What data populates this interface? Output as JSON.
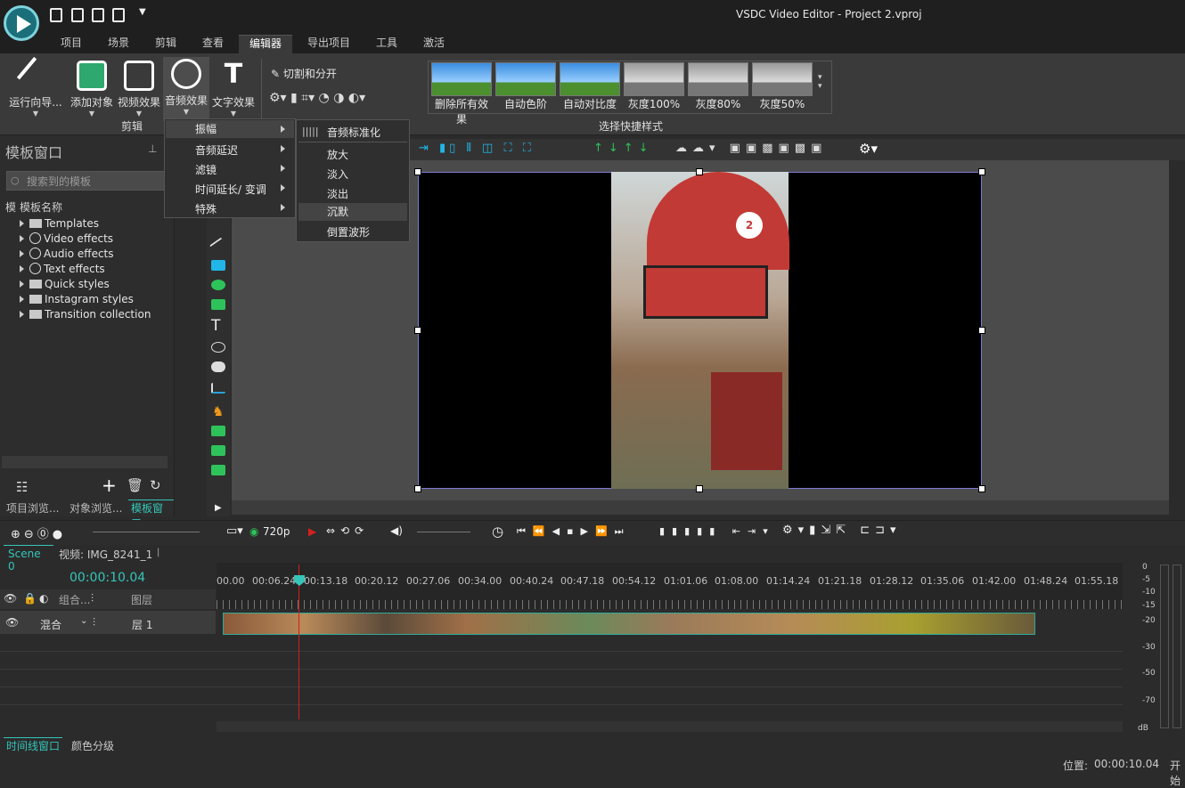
{
  "window": {
    "title": "VSDC Video Editor - Project 2.vproj"
  },
  "menu_tabs": [
    "项目",
    "场景",
    "剪辑",
    "查看",
    "编辑器",
    "导出项目",
    "工具",
    "激活"
  ],
  "ribbon": {
    "run_wizard": "运行向导...",
    "add_object": "添加对象",
    "video_effects": "视频效果",
    "audio_effects": "音频效果",
    "text_effects": "文字效果",
    "group_edit": "剪辑",
    "cut_split": "切割和分开",
    "quick_styles": [
      "删除所有效果",
      "自动色阶",
      "自动对比度",
      "灰度100%",
      "灰度80%",
      "灰度50%"
    ],
    "quick_styles_label": "选择快捷样式"
  },
  "audio_menu": {
    "items": [
      "振幅",
      "音频延迟",
      "滤镜",
      "时间延长/ 变调",
      "特殊"
    ],
    "sub": [
      "音频标准化",
      "放大",
      "淡入",
      "淡出",
      "沉默",
      "倒置波形"
    ]
  },
  "left_panel": {
    "title": "模板窗口",
    "search_placeholder": "搜索到的模板",
    "col_header": "模板名称",
    "col_prefix": "模",
    "items": [
      "Templates",
      "Video effects",
      "Audio effects",
      "Text effects",
      "Quick styles",
      "Instagram styles",
      "Transition collection"
    ],
    "tabs": [
      "项目浏览...",
      "对象浏览...",
      "模板窗口"
    ]
  },
  "playbar": {
    "resolution": "720p"
  },
  "timeline": {
    "scene_tab": "Scene 0",
    "clip_tab": "视频: IMG_8241_1",
    "timecode": "00:00:10.04",
    "ruler": [
      "00.00",
      "00:06.24",
      "00:13.18",
      "00:20.12",
      "00:27.06",
      "00:34.00",
      "00:40.24",
      "00:47.18",
      "00:54.12",
      "01:01.06",
      "01:08.00",
      "01:14.24",
      "01:21.18",
      "01:28.12",
      "01:35.06",
      "01:42.00",
      "01:48.24",
      "01:55.18"
    ],
    "header_blend": "混合",
    "header_blend_short": "组合...",
    "header_layers": "图层",
    "layer_name": "层 1",
    "vu_labels": [
      "0",
      "-5",
      "-10",
      "-15",
      "-20",
      "-30",
      "-50",
      "-70",
      "dB"
    ]
  },
  "status": {
    "tabs": [
      "时间线窗口",
      "颜色分级"
    ],
    "position_label": "位置:",
    "position_value": "00:00:10.04",
    "extra": "开始"
  },
  "colors": {
    "accent": "#35c6b9",
    "playhead": "#d02020"
  }
}
